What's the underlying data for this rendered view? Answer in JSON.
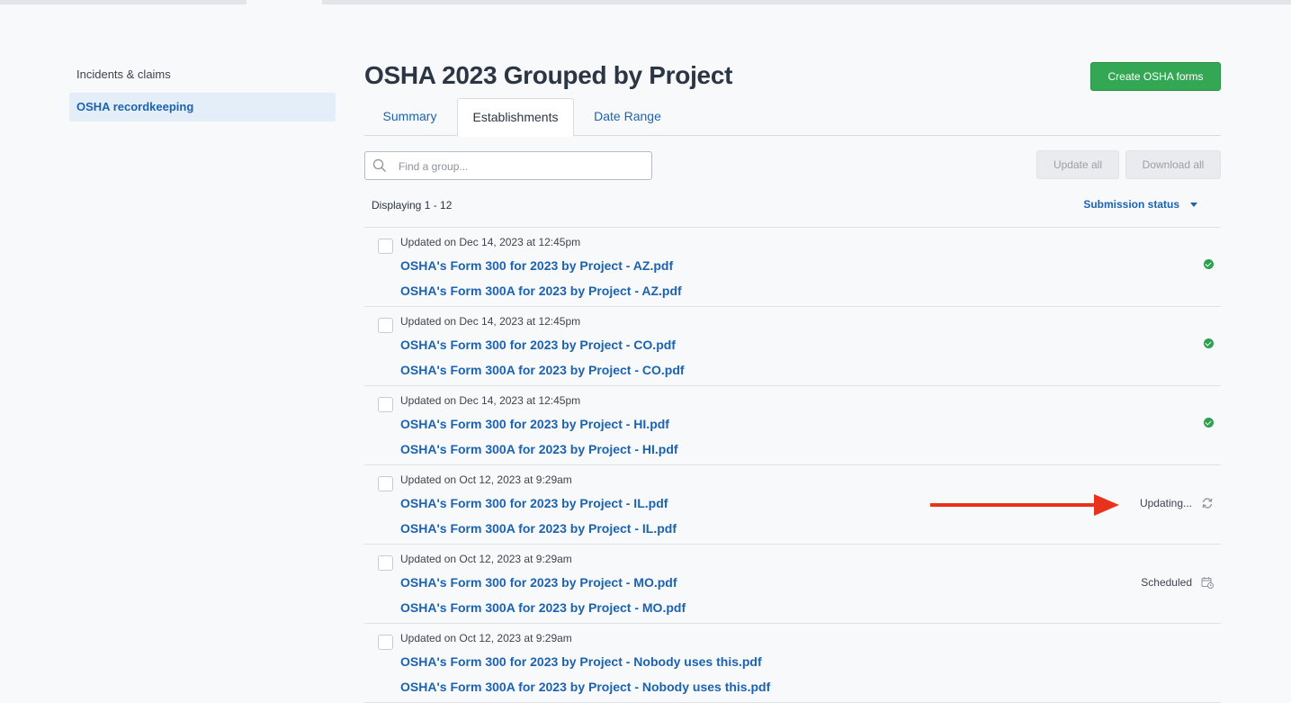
{
  "sidebar": {
    "items": [
      {
        "label": "Incidents & claims",
        "active": false
      },
      {
        "label": "OSHA recordkeeping",
        "active": true
      }
    ]
  },
  "header": {
    "title": "OSHA 2023 Grouped by Project",
    "create_label": "Create OSHA forms"
  },
  "tabs": [
    {
      "label": "Summary",
      "active": false
    },
    {
      "label": "Establishments",
      "active": true
    },
    {
      "label": "Date Range",
      "active": false
    }
  ],
  "search": {
    "placeholder": "Find a group..."
  },
  "toolbar": {
    "update_all": "Update all",
    "download_all": "Download all"
  },
  "list_meta": {
    "displaying": "Displaying 1 - 12",
    "sort_label": "Submission status"
  },
  "rows": [
    {
      "updated": "Updated on Dec 14, 2023 at 12:45pm",
      "file1": "OSHA's Form 300 for 2023 by Project - AZ.pdf",
      "file2": "OSHA's Form 300A for 2023 by Project - AZ.pdf",
      "status": "complete",
      "status_text": ""
    },
    {
      "updated": "Updated on Dec 14, 2023 at 12:45pm",
      "file1": "OSHA's Form 300 for 2023 by Project - CO.pdf",
      "file2": "OSHA's Form 300A for 2023 by Project - CO.pdf",
      "status": "complete",
      "status_text": ""
    },
    {
      "updated": "Updated on Dec 14, 2023 at 12:45pm",
      "file1": "OSHA's Form 300 for 2023 by Project - HI.pdf",
      "file2": "OSHA's Form 300A for 2023 by Project - HI.pdf",
      "status": "complete",
      "status_text": ""
    },
    {
      "updated": "Updated on Oct 12, 2023 at 9:29am",
      "file1": "OSHA's Form 300 for 2023 by Project - IL.pdf",
      "file2": "OSHA's Form 300A for 2023 by Project - IL.pdf",
      "status": "updating",
      "status_text": "Updating..."
    },
    {
      "updated": "Updated on Oct 12, 2023 at 9:29am",
      "file1": "OSHA's Form 300 for 2023 by Project - MO.pdf",
      "file2": "OSHA's Form 300A for 2023 by Project - MO.pdf",
      "status": "scheduled",
      "status_text": "Scheduled"
    },
    {
      "updated": "Updated on Oct 12, 2023 at 9:29am",
      "file1": "OSHA's Form 300 for 2023 by Project - Nobody uses this.pdf",
      "file2": "OSHA's Form 300A for 2023 by Project - Nobody uses this.pdf",
      "status": "none",
      "status_text": ""
    }
  ],
  "colors": {
    "accent": "#1b63b1",
    "success": "#2ea04f",
    "annotation_arrow": "#e8321e"
  }
}
